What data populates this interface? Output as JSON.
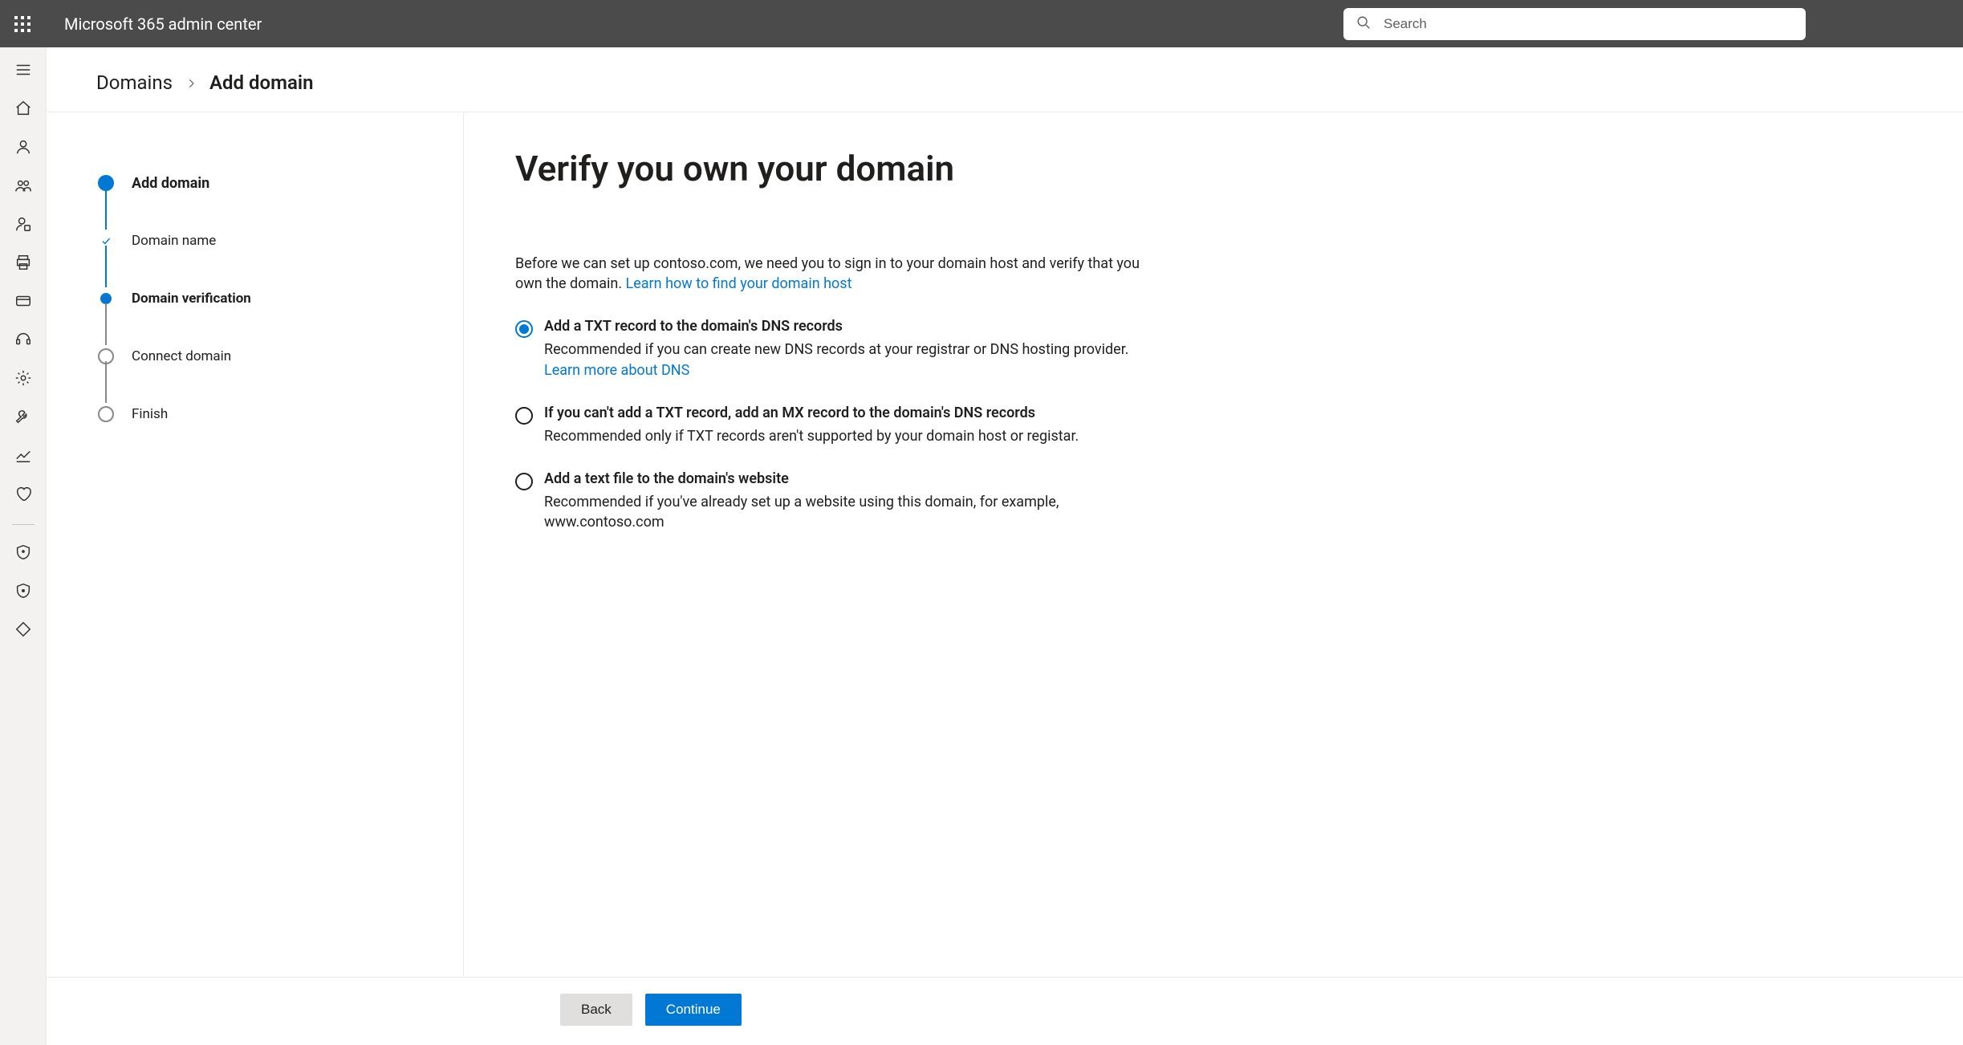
{
  "header": {
    "app_title": "Microsoft 365 admin center",
    "search_placeholder": "Search"
  },
  "breadcrumb": {
    "parent": "Domains",
    "current": "Add domain"
  },
  "nav_icons": [
    "menu-icon",
    "home-icon",
    "user-icon",
    "group-icon",
    "role-icon",
    "printer-icon",
    "billing-icon",
    "support-icon",
    "settings-icon",
    "wrench-icon",
    "reports-icon",
    "health-icon",
    "shield1-icon",
    "shield2-icon",
    "nav-more-icon"
  ],
  "stepper": {
    "steps": [
      {
        "label": "Add domain",
        "state": "major"
      },
      {
        "label": "Domain name",
        "state": "done"
      },
      {
        "label": "Domain verification",
        "state": "current"
      },
      {
        "label": "Connect domain",
        "state": "future"
      },
      {
        "label": "Finish",
        "state": "future"
      }
    ]
  },
  "main": {
    "title": "Verify you own your domain",
    "intro_part1": "Before we can set up contoso.com, we need you to sign in to your domain host and verify that you own the domain. ",
    "intro_link": "Learn how to find your domain host",
    "options": [
      {
        "title": "Add a TXT record to the domain's DNS records",
        "desc": "Recommended if you can create new DNS records at your registrar or DNS hosting provider. ",
        "link": "Learn more about DNS",
        "checked": true
      },
      {
        "title": "If you can't add a TXT record, add an MX record to the domain's DNS records",
        "desc": "Recommended only if TXT records aren't supported by your domain host or registar.",
        "link": "",
        "checked": false
      },
      {
        "title": "Add a text file to the domain's website",
        "desc": "Recommended if you've already set up a website using this domain, for example, www.contoso.com",
        "link": "",
        "checked": false
      }
    ]
  },
  "footer": {
    "back": "Back",
    "continue": "Continue"
  }
}
